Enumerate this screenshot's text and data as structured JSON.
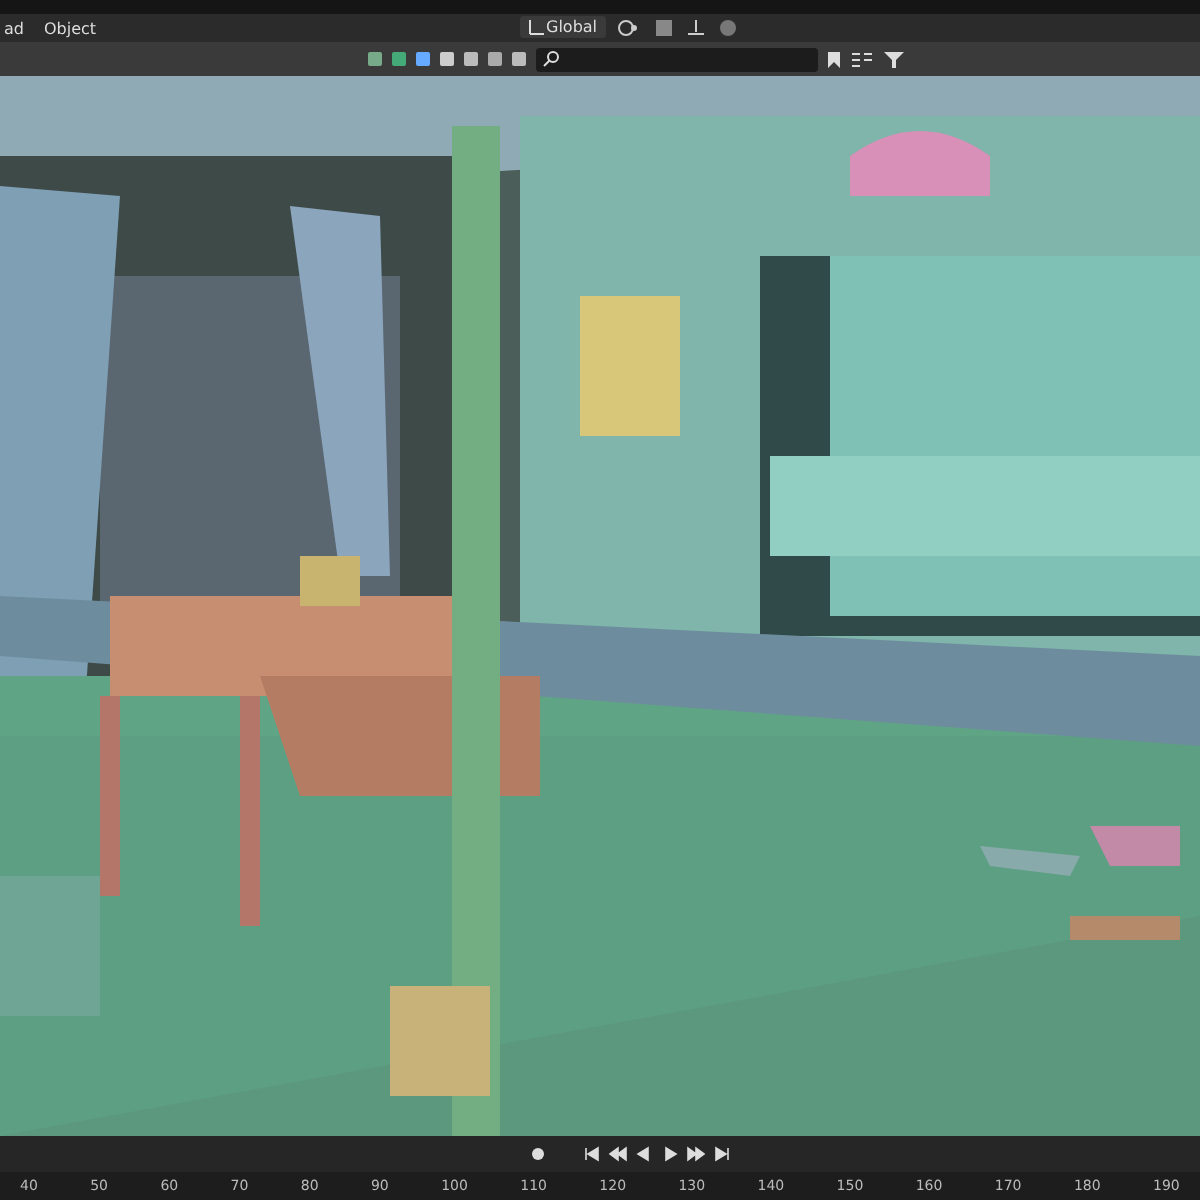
{
  "header": {
    "mode_labels": [
      "ad",
      "Object"
    ],
    "orientation": "Global"
  },
  "timeline": {
    "frames": [
      "40",
      "50",
      "60",
      "70",
      "80",
      "90",
      "100",
      "110",
      "120",
      "130",
      "140",
      "150",
      "160",
      "170",
      "180",
      "190"
    ]
  }
}
